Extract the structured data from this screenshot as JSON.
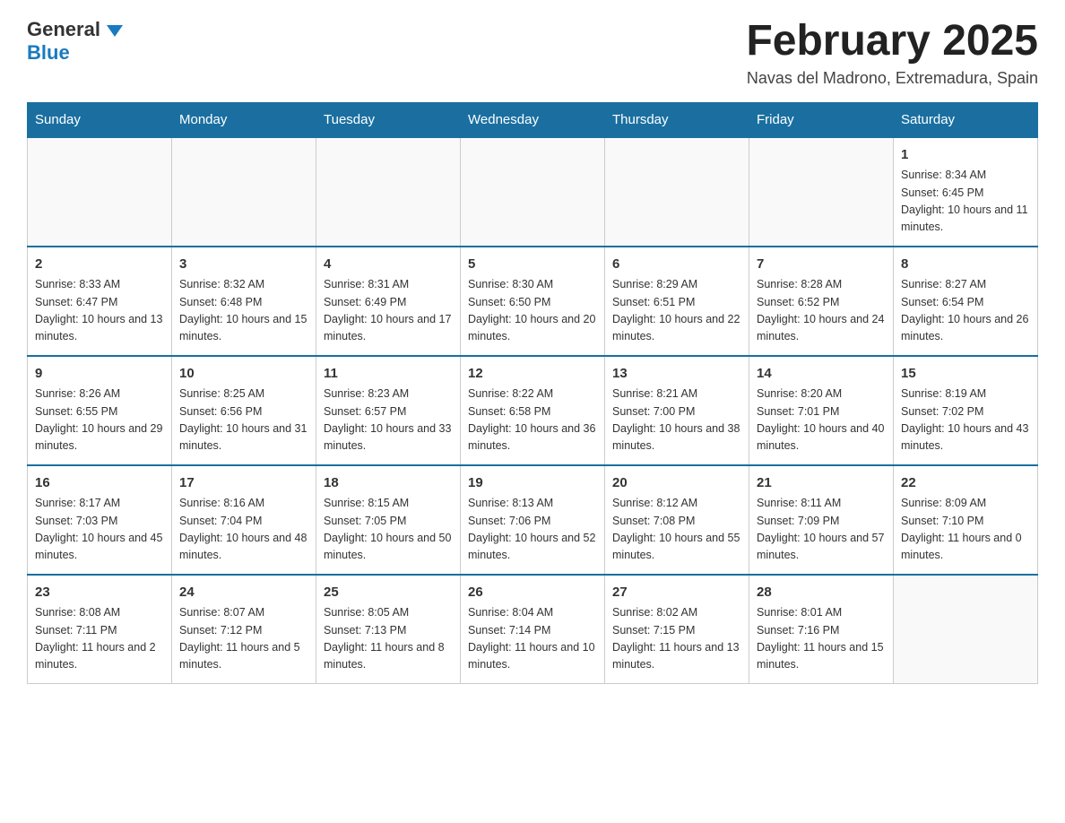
{
  "header": {
    "logo_main": "General",
    "logo_sub": "Blue",
    "month_title": "February 2025",
    "location": "Navas del Madrono, Extremadura, Spain"
  },
  "days_of_week": [
    "Sunday",
    "Monday",
    "Tuesday",
    "Wednesday",
    "Thursday",
    "Friday",
    "Saturday"
  ],
  "weeks": [
    [
      {
        "day": "",
        "info": ""
      },
      {
        "day": "",
        "info": ""
      },
      {
        "day": "",
        "info": ""
      },
      {
        "day": "",
        "info": ""
      },
      {
        "day": "",
        "info": ""
      },
      {
        "day": "",
        "info": ""
      },
      {
        "day": "1",
        "info": "Sunrise: 8:34 AM\nSunset: 6:45 PM\nDaylight: 10 hours and 11 minutes."
      }
    ],
    [
      {
        "day": "2",
        "info": "Sunrise: 8:33 AM\nSunset: 6:47 PM\nDaylight: 10 hours and 13 minutes."
      },
      {
        "day": "3",
        "info": "Sunrise: 8:32 AM\nSunset: 6:48 PM\nDaylight: 10 hours and 15 minutes."
      },
      {
        "day": "4",
        "info": "Sunrise: 8:31 AM\nSunset: 6:49 PM\nDaylight: 10 hours and 17 minutes."
      },
      {
        "day": "5",
        "info": "Sunrise: 8:30 AM\nSunset: 6:50 PM\nDaylight: 10 hours and 20 minutes."
      },
      {
        "day": "6",
        "info": "Sunrise: 8:29 AM\nSunset: 6:51 PM\nDaylight: 10 hours and 22 minutes."
      },
      {
        "day": "7",
        "info": "Sunrise: 8:28 AM\nSunset: 6:52 PM\nDaylight: 10 hours and 24 minutes."
      },
      {
        "day": "8",
        "info": "Sunrise: 8:27 AM\nSunset: 6:54 PM\nDaylight: 10 hours and 26 minutes."
      }
    ],
    [
      {
        "day": "9",
        "info": "Sunrise: 8:26 AM\nSunset: 6:55 PM\nDaylight: 10 hours and 29 minutes."
      },
      {
        "day": "10",
        "info": "Sunrise: 8:25 AM\nSunset: 6:56 PM\nDaylight: 10 hours and 31 minutes."
      },
      {
        "day": "11",
        "info": "Sunrise: 8:23 AM\nSunset: 6:57 PM\nDaylight: 10 hours and 33 minutes."
      },
      {
        "day": "12",
        "info": "Sunrise: 8:22 AM\nSunset: 6:58 PM\nDaylight: 10 hours and 36 minutes."
      },
      {
        "day": "13",
        "info": "Sunrise: 8:21 AM\nSunset: 7:00 PM\nDaylight: 10 hours and 38 minutes."
      },
      {
        "day": "14",
        "info": "Sunrise: 8:20 AM\nSunset: 7:01 PM\nDaylight: 10 hours and 40 minutes."
      },
      {
        "day": "15",
        "info": "Sunrise: 8:19 AM\nSunset: 7:02 PM\nDaylight: 10 hours and 43 minutes."
      }
    ],
    [
      {
        "day": "16",
        "info": "Sunrise: 8:17 AM\nSunset: 7:03 PM\nDaylight: 10 hours and 45 minutes."
      },
      {
        "day": "17",
        "info": "Sunrise: 8:16 AM\nSunset: 7:04 PM\nDaylight: 10 hours and 48 minutes."
      },
      {
        "day": "18",
        "info": "Sunrise: 8:15 AM\nSunset: 7:05 PM\nDaylight: 10 hours and 50 minutes."
      },
      {
        "day": "19",
        "info": "Sunrise: 8:13 AM\nSunset: 7:06 PM\nDaylight: 10 hours and 52 minutes."
      },
      {
        "day": "20",
        "info": "Sunrise: 8:12 AM\nSunset: 7:08 PM\nDaylight: 10 hours and 55 minutes."
      },
      {
        "day": "21",
        "info": "Sunrise: 8:11 AM\nSunset: 7:09 PM\nDaylight: 10 hours and 57 minutes."
      },
      {
        "day": "22",
        "info": "Sunrise: 8:09 AM\nSunset: 7:10 PM\nDaylight: 11 hours and 0 minutes."
      }
    ],
    [
      {
        "day": "23",
        "info": "Sunrise: 8:08 AM\nSunset: 7:11 PM\nDaylight: 11 hours and 2 minutes."
      },
      {
        "day": "24",
        "info": "Sunrise: 8:07 AM\nSunset: 7:12 PM\nDaylight: 11 hours and 5 minutes."
      },
      {
        "day": "25",
        "info": "Sunrise: 8:05 AM\nSunset: 7:13 PM\nDaylight: 11 hours and 8 minutes."
      },
      {
        "day": "26",
        "info": "Sunrise: 8:04 AM\nSunset: 7:14 PM\nDaylight: 11 hours and 10 minutes."
      },
      {
        "day": "27",
        "info": "Sunrise: 8:02 AM\nSunset: 7:15 PM\nDaylight: 11 hours and 13 minutes."
      },
      {
        "day": "28",
        "info": "Sunrise: 8:01 AM\nSunset: 7:16 PM\nDaylight: 11 hours and 15 minutes."
      },
      {
        "day": "",
        "info": ""
      }
    ]
  ]
}
